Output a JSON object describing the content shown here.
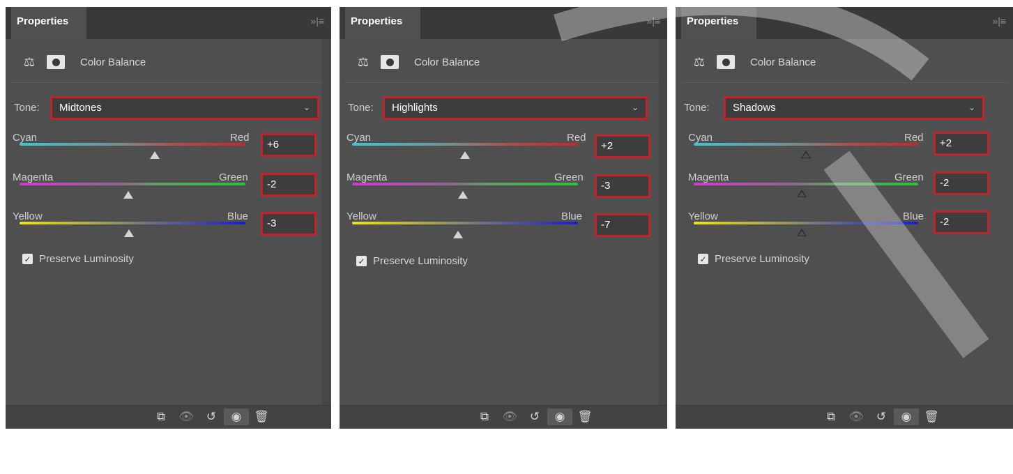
{
  "panels": [
    {
      "tab_title": "Properties",
      "header_icons": "»|≡",
      "adjustment_title": "Color Balance",
      "tone_label": "Tone:",
      "tone_value": "Midtones",
      "sliders": [
        {
          "left": "Cyan",
          "right": "Red",
          "value": "+6",
          "position": 0.6
        },
        {
          "left": "Magenta",
          "right": "Green",
          "value": "-2",
          "position": 0.48
        },
        {
          "left": "Yellow",
          "right": "Blue",
          "value": "-3",
          "position": 0.485
        }
      ],
      "preserve_label": "Preserve Luminosity",
      "preserve_checked": true
    },
    {
      "tab_title": "Properties",
      "header_icons": "»|≡",
      "adjustment_title": "Color Balance",
      "tone_label": "Tone:",
      "tone_value": "Highlights",
      "sliders": [
        {
          "left": "Cyan",
          "right": "Red",
          "value": "+2",
          "position": 0.5
        },
        {
          "left": "Magenta",
          "right": "Green",
          "value": "-3",
          "position": 0.49
        },
        {
          "left": "Yellow",
          "right": "Blue",
          "value": "-7",
          "position": 0.47
        }
      ],
      "preserve_label": "Preserve Luminosity",
      "preserve_checked": true
    },
    {
      "tab_title": "Properties",
      "header_icons": "»|≡",
      "adjustment_title": "Color Balance",
      "tone_label": "Tone:",
      "tone_value": "Shadows",
      "sliders": [
        {
          "left": "Cyan",
          "right": "Red",
          "value": "+2",
          "position": 0.5
        },
        {
          "left": "Magenta",
          "right": "Green",
          "value": "-2",
          "position": 0.48
        },
        {
          "left": "Yellow",
          "right": "Blue",
          "value": "-2",
          "position": 0.48
        }
      ],
      "preserve_label": "Preserve Luminosity",
      "preserve_checked": true
    }
  ],
  "colors": {
    "panel_bg": "#4f4f4f",
    "header_bg": "#393939",
    "highlight_border": "#c3222b",
    "cyan": "#35c9d6",
    "red": "#d0242a",
    "magenta": "#d23ad2",
    "green": "#27c13a",
    "yellow": "#f0e21c",
    "blue": "#1a1fc8"
  },
  "footer_icons": [
    "clip-to-layer-icon",
    "view-previous-icon",
    "reset-icon",
    "visibility-eye-icon",
    "trash-icon"
  ]
}
